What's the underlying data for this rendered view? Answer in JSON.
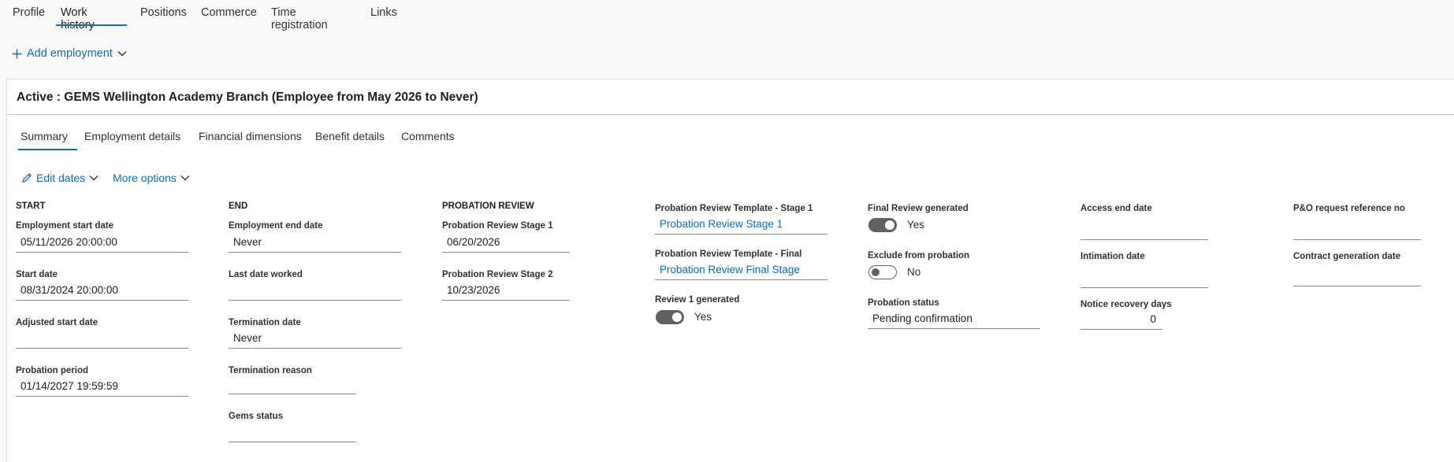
{
  "topnav": {
    "tabs": [
      "Profile",
      "Work history",
      "Positions",
      "Commerce",
      "Time registration",
      "Links"
    ],
    "active": "Work history"
  },
  "add_employment": "Add employment",
  "panel": {
    "title": "Active : GEMS Wellington Academy Branch (Employee from May 2026 to Never)",
    "tabs": [
      "Summary",
      "Employment details",
      "Financial dimensions",
      "Benefit details",
      "Comments"
    ],
    "active_tab": "Summary",
    "actions": {
      "edit_dates": "Edit dates",
      "more_options": "More options"
    }
  },
  "start": {
    "heading": "START",
    "employment_start_date_label": "Employment start date",
    "employment_start_date": "05/11/2026 20:00:00",
    "start_date_label": "Start date",
    "start_date": "08/31/2024 20:00:00",
    "adjusted_start_date_label": "Adjusted start date",
    "adjusted_start_date": "",
    "probation_period_label": "Probation period",
    "probation_period": "01/14/2027 19:59:59"
  },
  "end": {
    "heading": "END",
    "employment_end_date_label": "Employment end date",
    "employment_end_date": "Never",
    "last_date_worked_label": "Last date worked",
    "last_date_worked": "",
    "termination_date_label": "Termination date",
    "termination_date": "Never",
    "termination_reason_label": "Termination reason",
    "termination_reason": "",
    "gems_status_label": "Gems status",
    "gems_status": ""
  },
  "probation_review": {
    "heading": "PROBATION REVIEW",
    "stage1_label": "Probation Review Stage 1",
    "stage1": "06/20/2026",
    "stage2_label": "Probation Review Stage 2",
    "stage2": "10/23/2026"
  },
  "templates": {
    "stage1_label": "Probation Review Template - Stage 1",
    "stage1": "Probation Review Stage 1",
    "final_label": "Probation Review Template - Final",
    "final": "Probation Review Final Stage",
    "review1_label": "Review 1 generated",
    "review1": "Yes"
  },
  "final_review": {
    "generated_label": "Final Review generated",
    "generated": "Yes",
    "exclude_label": "Exclude from probation",
    "exclude": "No",
    "status_label": "Probation status",
    "status": "Pending confirmation"
  },
  "access": {
    "access_end_label": "Access end date",
    "access_end": "",
    "intimation_label": "Intimation date",
    "intimation": "",
    "notice_label": "Notice recovery days",
    "notice": "0"
  },
  "po": {
    "ref_label": "P&O request reference no",
    "ref": "",
    "contract_label": "Contract generation date",
    "contract": ""
  },
  "colors": {
    "accent": "#0f6cbd",
    "toggle": "#616161"
  }
}
